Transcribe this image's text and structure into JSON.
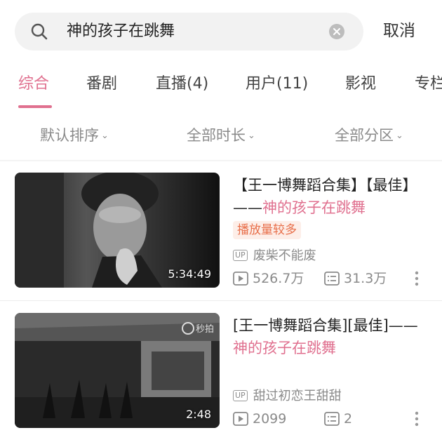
{
  "search": {
    "query": "神的孩子在跳舞",
    "cancel_label": "取消"
  },
  "tabs": [
    {
      "label": "综合",
      "active": true
    },
    {
      "label": "番剧"
    },
    {
      "label": "直播(4)"
    },
    {
      "label": "用户(11)"
    },
    {
      "label": "影视"
    },
    {
      "label": "专栏"
    }
  ],
  "filters": [
    {
      "label": "默认排序"
    },
    {
      "label": "全部时长"
    },
    {
      "label": "全部分区"
    }
  ],
  "colors": {
    "accent": "#e0708f",
    "badge_text": "#e86f4a",
    "badge_bg": "#fdeee8",
    "muted": "#8a8a8a"
  },
  "videos": [
    {
      "title_prefix": "【王一博舞蹈合集】【最佳】——",
      "title_highlight": "神的孩子在跳舞",
      "badge": "播放量较多",
      "duration": "5:34:49",
      "up_tag": "UP",
      "uploader": "废柴不能废",
      "plays": "526.7万",
      "danmaku": "31.3万"
    },
    {
      "title_prefix": "[王一博舞蹈合集][最佳]——",
      "title_highlight": "神的孩子在跳舞",
      "badge": "",
      "duration": "2:48",
      "up_tag": "UP",
      "uploader": "甜过初恋王甜甜",
      "plays": "2099",
      "danmaku": "2"
    }
  ]
}
